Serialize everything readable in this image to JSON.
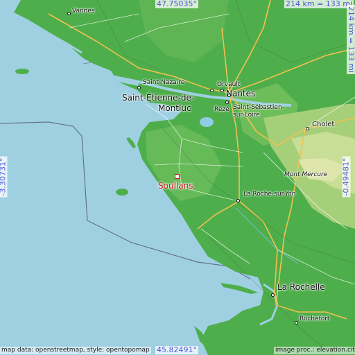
{
  "map": {
    "focus_place": "Soullans",
    "coords": {
      "top": "47.75035°",
      "bottom": "45.82491°",
      "left": "-3.30731°",
      "right": "-0.49481°"
    },
    "scale": {
      "horizontal": "214 km = 133 mi",
      "vertical": "214 km = 133 mi"
    },
    "attribution": {
      "left": "map data: openstreetmap, style: opentopomap",
      "right": "image proc.: elevation.city"
    },
    "places": [
      {
        "key": "vannes",
        "label": "Vannes"
      },
      {
        "key": "saint-nazaire",
        "label": "Saint-Nazaire"
      },
      {
        "key": "orvault",
        "label": "Orvault"
      },
      {
        "key": "nantes",
        "label": "Nantes"
      },
      {
        "key": "saint-etienne-line1",
        "label": "Saint-Étienne-de-"
      },
      {
        "key": "saint-etienne-line2",
        "label": "Montluc"
      },
      {
        "key": "reze",
        "label": "Rezé"
      },
      {
        "key": "saint-sebastien-line1",
        "label": "Saint-Sébastien-"
      },
      {
        "key": "saint-sebastien-line2",
        "label": "sur-Loire"
      },
      {
        "key": "cholet",
        "label": "Cholet"
      },
      {
        "key": "mont-mercure",
        "label": "Mont Mercure"
      },
      {
        "key": "la-roche-sur-yon",
        "label": "La Roche-sur-Yon"
      },
      {
        "key": "la-rochelle",
        "label": "La Rochelle"
      },
      {
        "key": "rochefort",
        "label": "Rochefort"
      }
    ],
    "colors": {
      "sea": "#9fd0e2",
      "land": "#4fae4c",
      "land_light": "#7cc46a",
      "highland": "#b9d98a",
      "road": "#f2c14e",
      "accent": "#d1161d",
      "coord_text": "#4a59d6"
    }
  }
}
